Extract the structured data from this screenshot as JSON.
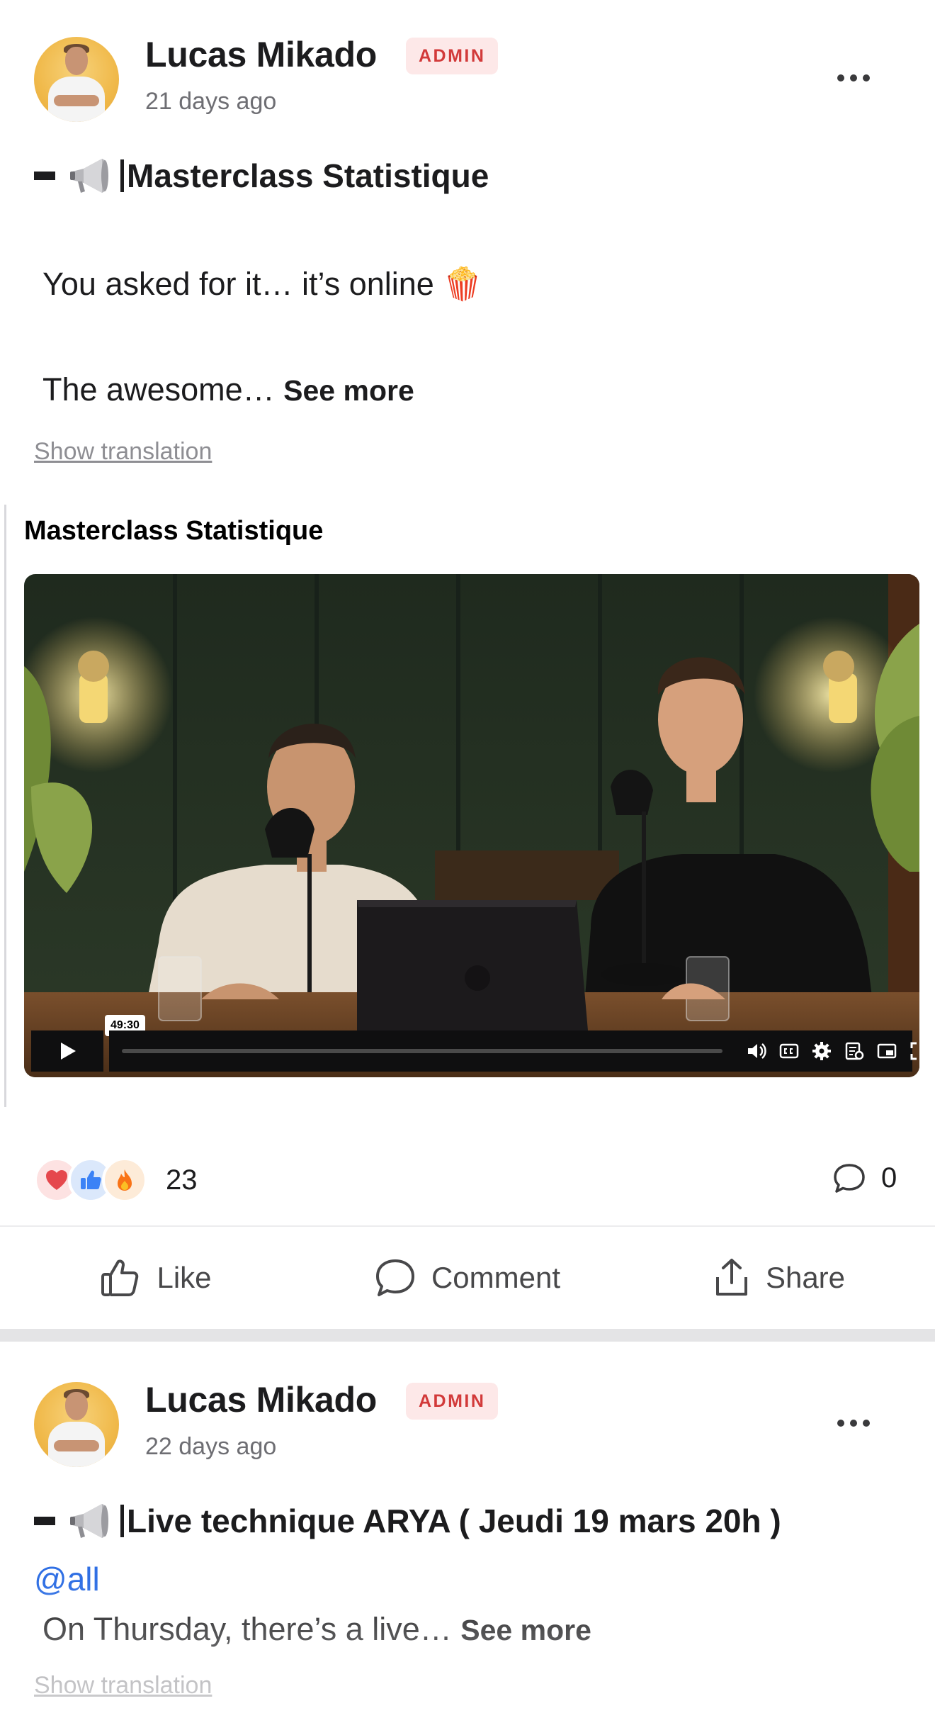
{
  "posts": [
    {
      "author": "Lucas Mikado",
      "badge": "ADMIN",
      "time": "21 days ago",
      "title": "Masterclass Statistique",
      "body_line_1": "You asked for it… it’s online 🍿",
      "body_line_2": "The awesome… ",
      "see_more": "See more",
      "show_translation": "Show translation",
      "embed_title": "Masterclass Statistique",
      "video": {
        "timecode": "49:30"
      },
      "reactions": {
        "icons": [
          "heart-icon",
          "thumbs-up-icon",
          "fire-icon"
        ],
        "count": "23"
      },
      "comments_count": "0"
    },
    {
      "author": "Lucas Mikado",
      "badge": "ADMIN",
      "time": "22 days ago",
      "title": "Live technique ARYA ( Jeudi 19 mars 20h )",
      "mention": "@all",
      "body_line_1": "On Thursday, there’s a live… ",
      "see_more": "See more",
      "show_translation": "Show translation"
    }
  ],
  "actions": {
    "like": "Like",
    "comment": "Comment",
    "share": "Share"
  },
  "colors": {
    "accent": "#2f6fe4",
    "badge_bg": "#fde8e8",
    "badge_text": "#d23a3a",
    "muted": "#6e6e73"
  },
  "icons": {
    "more": "more-horizontal-icon",
    "megaphone": "megaphone-icon",
    "like": "thumbs-up-icon",
    "comment": "speech-bubble-icon",
    "share": "share-icon"
  }
}
